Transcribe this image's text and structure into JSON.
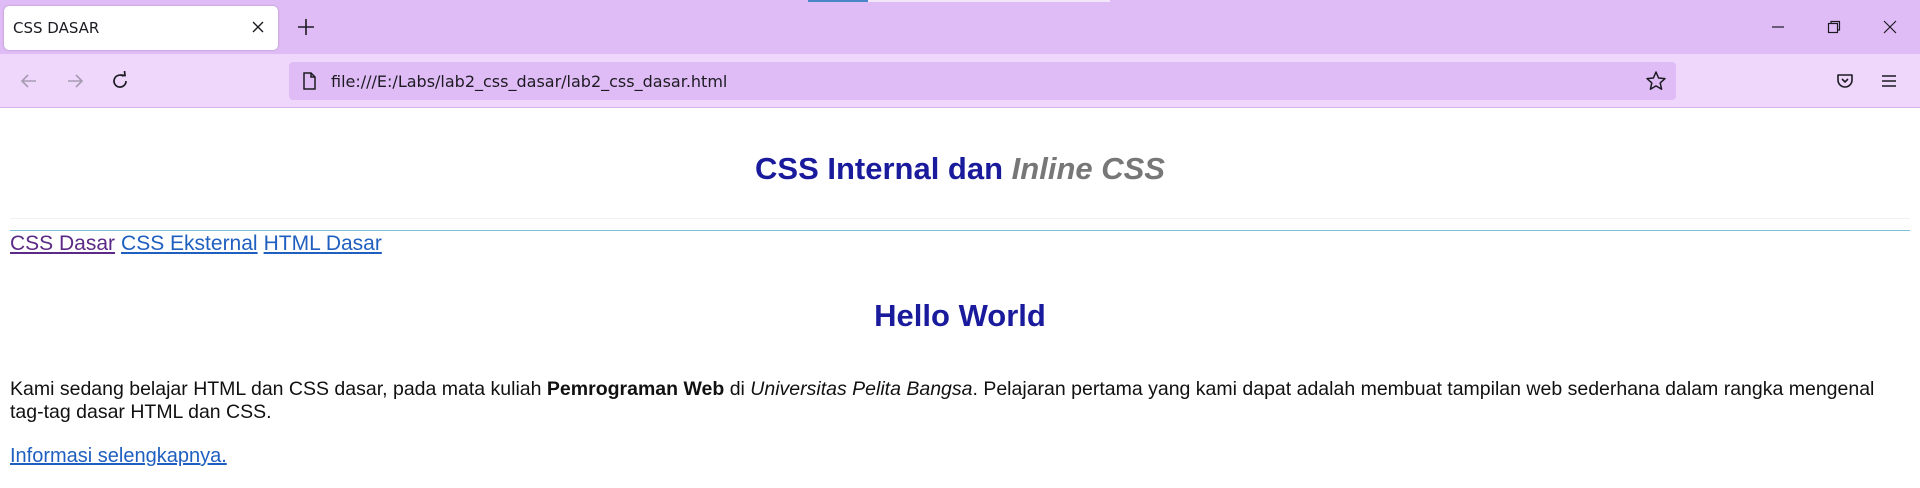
{
  "browser": {
    "tab_title": "CSS DASAR",
    "url": "file:///E:/Labs/lab2_css_dasar/lab2_css_dasar.html",
    "accent_color": "#e0bcf6",
    "toolbar_color": "#eed7fb"
  },
  "icons": {
    "tab_close": "close-icon",
    "new_tab": "plus-icon",
    "minimize": "minimize-icon",
    "restore": "restore-icon",
    "close_window": "close-icon",
    "back": "arrow-left-icon",
    "forward": "arrow-right-icon",
    "reload": "reload-icon",
    "page": "page-icon",
    "bookmark": "star-icon",
    "pocket": "pocket-icon",
    "menu": "hamburger-icon"
  },
  "page": {
    "heading_main": "CSS Internal dan ",
    "heading_inline": "Inline CSS",
    "nav_links": [
      "CSS Dasar",
      "CSS Eksternal",
      "HTML Dasar"
    ],
    "hello": "Hello World",
    "paragraph": {
      "part1": "Kami sedang belajar HTML dan CSS dasar, pada mata kuliah ",
      "bold": "Pemrograman Web",
      "part2": " di ",
      "italic": "Universitas Pelita Bangsa",
      "part3": ". Pelajaran pertama yang kami dapat adalah membuat tampilan web sederhana dalam rangka mengenal tag-tag dasar HTML dan CSS."
    },
    "more_link": "Informasi selengkapnya.",
    "colors": {
      "heading": "#1a1a9c",
      "inline_heading": "#777777",
      "link": "#1f5fbf",
      "visited_link": "#5b2a86"
    }
  }
}
